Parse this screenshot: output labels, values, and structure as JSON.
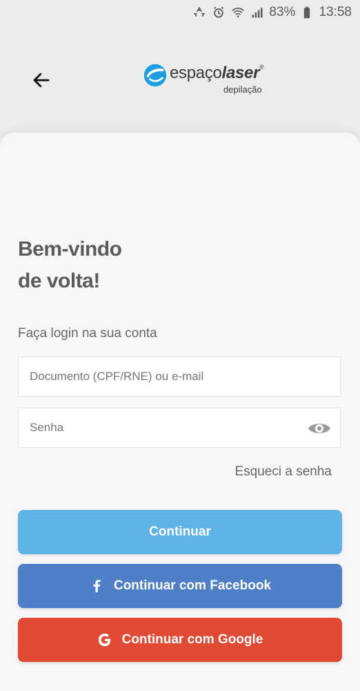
{
  "status_bar": {
    "battery": "83%",
    "time": "13:58",
    "icons": [
      "recycle-icon",
      "alarm-icon",
      "wifi-icon",
      "signal-icon",
      "battery-icon"
    ]
  },
  "header": {
    "back_icon": "arrow-left-icon",
    "logo": {
      "brand_light": "espaço",
      "brand_bold": "laser",
      "registered": "®",
      "sub": "depilação",
      "color": "#1a9ee0"
    }
  },
  "login": {
    "welcome_line1": "Bem-vindo",
    "welcome_line2": "de volta!",
    "subtitle": "Faça login na sua conta",
    "document_placeholder": "Documento (CPF/RNE) ou e-mail",
    "password_placeholder": "Senha",
    "forgot_password": "Esqueci a senha",
    "continue_label": "Continuar",
    "facebook_label": "Continuar com Facebook",
    "google_label": "Continuar com Google"
  },
  "colors": {
    "primary": "#5fb2e6",
    "facebook": "#4f7fc7",
    "google": "#e04a33",
    "card": "#f7f7f9"
  }
}
